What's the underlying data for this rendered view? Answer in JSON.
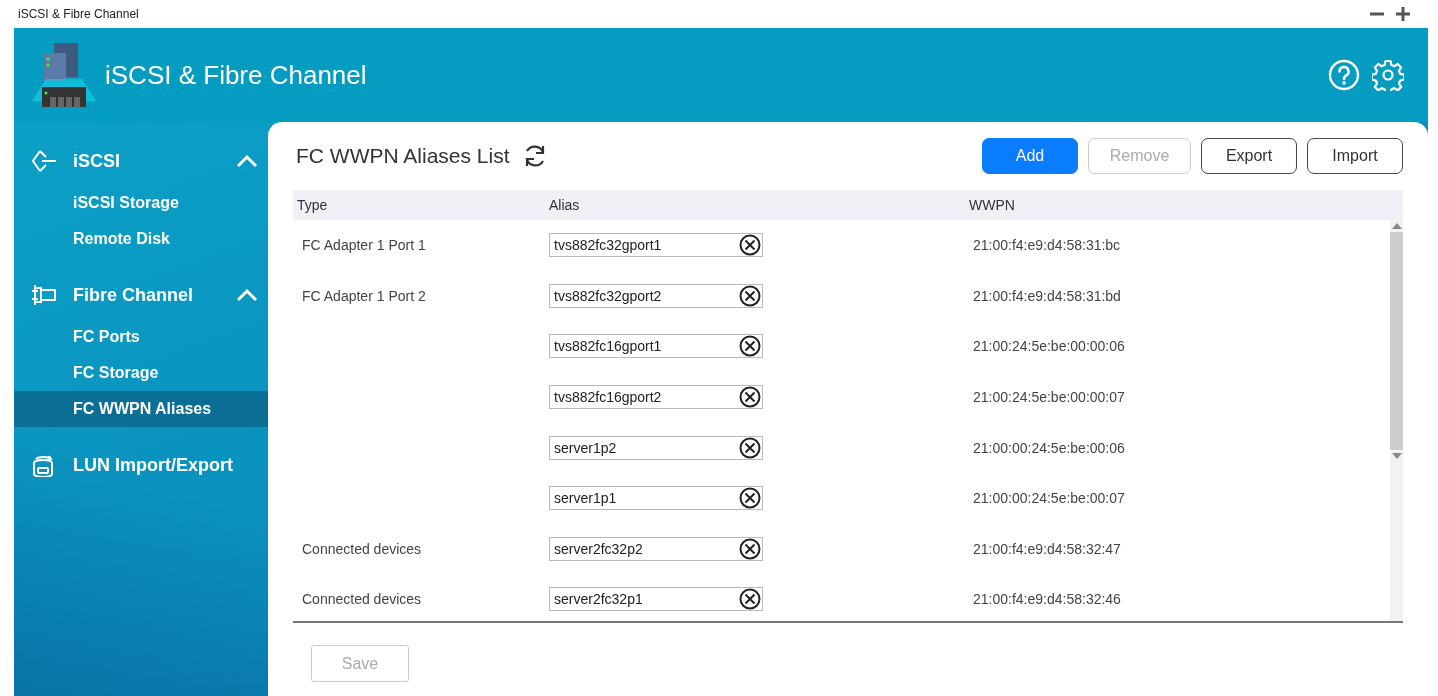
{
  "window": {
    "title": "iSCSI & Fibre Channel"
  },
  "header": {
    "title": "iSCSI & Fibre Channel"
  },
  "sidebar": {
    "groups": [
      {
        "label": "iSCSI",
        "kind": "iscsi",
        "expanded": true,
        "children": [
          {
            "label": "iSCSI Storage",
            "selected": false
          },
          {
            "label": "Remote Disk",
            "selected": false
          }
        ]
      },
      {
        "label": "Fibre Channel",
        "kind": "fibre",
        "expanded": true,
        "children": [
          {
            "label": "FC Ports",
            "selected": false
          },
          {
            "label": "FC Storage",
            "selected": false
          },
          {
            "label": "FC WWPN Aliases",
            "selected": true
          }
        ]
      },
      {
        "label": "LUN Import/Export",
        "kind": "lun"
      }
    ]
  },
  "panel": {
    "title": "FC WWPN Aliases List",
    "buttons": [
      {
        "label": "Add",
        "kind": "primary",
        "disabled": false
      },
      {
        "label": "Remove",
        "kind": "default",
        "disabled": true
      },
      {
        "label": "Export",
        "kind": "default",
        "disabled": false
      },
      {
        "label": "Import",
        "kind": "default",
        "disabled": false
      }
    ],
    "table": {
      "columns": [
        "Type",
        "Alias",
        "WWPN"
      ],
      "rows": [
        {
          "type": "FC Adapter 1 Port 1",
          "alias": "tvs882fc32gport1",
          "wwpn": "21:00:f4:e9:d4:58:31:bc"
        },
        {
          "type": "FC Adapter 1 Port 2",
          "alias": "tvs882fc32gport2",
          "wwpn": "21:00:f4:e9:d4:58:31:bd"
        },
        {
          "alias": "tvs882fc16gport1",
          "wwpn": "21:00:24:5e:be:00:00:06"
        },
        {
          "alias": "tvs882fc16gport2",
          "wwpn": "21:00:24:5e:be:00:00:07"
        },
        {
          "alias": "server1p2",
          "wwpn": "21:00:00:24:5e:be:00:06"
        },
        {
          "alias": "server1p1",
          "wwpn": "21:00:00:24:5e:be:00:07"
        },
        {
          "type": "Connected devices",
          "alias": "server2fc32p2",
          "wwpn": "21:00:f4:e9:d4:58:32:47"
        },
        {
          "type": "Connected devices",
          "alias": "server2fc32p1",
          "wwpn": "21:00:f4:e9:d4:58:32:46"
        }
      ]
    },
    "save_button": {
      "label": "Save",
      "disabled": true
    }
  }
}
